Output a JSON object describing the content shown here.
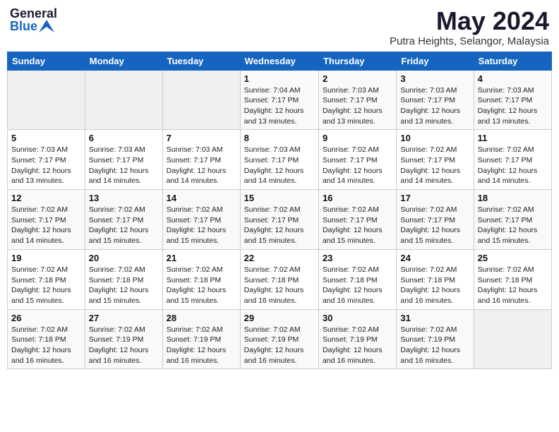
{
  "header": {
    "logo_general": "General",
    "logo_blue": "Blue",
    "month_title": "May 2024",
    "location": "Putra Heights, Selangor, Malaysia"
  },
  "days_of_week": [
    "Sunday",
    "Monday",
    "Tuesday",
    "Wednesday",
    "Thursday",
    "Friday",
    "Saturday"
  ],
  "weeks": [
    [
      {
        "day": "",
        "info": ""
      },
      {
        "day": "",
        "info": ""
      },
      {
        "day": "",
        "info": ""
      },
      {
        "day": "1",
        "info": "Sunrise: 7:04 AM\nSunset: 7:17 PM\nDaylight: 12 hours\nand 13 minutes."
      },
      {
        "day": "2",
        "info": "Sunrise: 7:03 AM\nSunset: 7:17 PM\nDaylight: 12 hours\nand 13 minutes."
      },
      {
        "day": "3",
        "info": "Sunrise: 7:03 AM\nSunset: 7:17 PM\nDaylight: 12 hours\nand 13 minutes."
      },
      {
        "day": "4",
        "info": "Sunrise: 7:03 AM\nSunset: 7:17 PM\nDaylight: 12 hours\nand 13 minutes."
      }
    ],
    [
      {
        "day": "5",
        "info": "Sunrise: 7:03 AM\nSunset: 7:17 PM\nDaylight: 12 hours\nand 13 minutes."
      },
      {
        "day": "6",
        "info": "Sunrise: 7:03 AM\nSunset: 7:17 PM\nDaylight: 12 hours\nand 14 minutes."
      },
      {
        "day": "7",
        "info": "Sunrise: 7:03 AM\nSunset: 7:17 PM\nDaylight: 12 hours\nand 14 minutes."
      },
      {
        "day": "8",
        "info": "Sunrise: 7:03 AM\nSunset: 7:17 PM\nDaylight: 12 hours\nand 14 minutes."
      },
      {
        "day": "9",
        "info": "Sunrise: 7:02 AM\nSunset: 7:17 PM\nDaylight: 12 hours\nand 14 minutes."
      },
      {
        "day": "10",
        "info": "Sunrise: 7:02 AM\nSunset: 7:17 PM\nDaylight: 12 hours\nand 14 minutes."
      },
      {
        "day": "11",
        "info": "Sunrise: 7:02 AM\nSunset: 7:17 PM\nDaylight: 12 hours\nand 14 minutes."
      }
    ],
    [
      {
        "day": "12",
        "info": "Sunrise: 7:02 AM\nSunset: 7:17 PM\nDaylight: 12 hours\nand 14 minutes."
      },
      {
        "day": "13",
        "info": "Sunrise: 7:02 AM\nSunset: 7:17 PM\nDaylight: 12 hours\nand 15 minutes."
      },
      {
        "day": "14",
        "info": "Sunrise: 7:02 AM\nSunset: 7:17 PM\nDaylight: 12 hours\nand 15 minutes."
      },
      {
        "day": "15",
        "info": "Sunrise: 7:02 AM\nSunset: 7:17 PM\nDaylight: 12 hours\nand 15 minutes."
      },
      {
        "day": "16",
        "info": "Sunrise: 7:02 AM\nSunset: 7:17 PM\nDaylight: 12 hours\nand 15 minutes."
      },
      {
        "day": "17",
        "info": "Sunrise: 7:02 AM\nSunset: 7:17 PM\nDaylight: 12 hours\nand 15 minutes."
      },
      {
        "day": "18",
        "info": "Sunrise: 7:02 AM\nSunset: 7:17 PM\nDaylight: 12 hours\nand 15 minutes."
      }
    ],
    [
      {
        "day": "19",
        "info": "Sunrise: 7:02 AM\nSunset: 7:18 PM\nDaylight: 12 hours\nand 15 minutes."
      },
      {
        "day": "20",
        "info": "Sunrise: 7:02 AM\nSunset: 7:18 PM\nDaylight: 12 hours\nand 15 minutes."
      },
      {
        "day": "21",
        "info": "Sunrise: 7:02 AM\nSunset: 7:18 PM\nDaylight: 12 hours\nand 15 minutes."
      },
      {
        "day": "22",
        "info": "Sunrise: 7:02 AM\nSunset: 7:18 PM\nDaylight: 12 hours\nand 16 minutes."
      },
      {
        "day": "23",
        "info": "Sunrise: 7:02 AM\nSunset: 7:18 PM\nDaylight: 12 hours\nand 16 minutes."
      },
      {
        "day": "24",
        "info": "Sunrise: 7:02 AM\nSunset: 7:18 PM\nDaylight: 12 hours\nand 16 minutes."
      },
      {
        "day": "25",
        "info": "Sunrise: 7:02 AM\nSunset: 7:18 PM\nDaylight: 12 hours\nand 16 minutes."
      }
    ],
    [
      {
        "day": "26",
        "info": "Sunrise: 7:02 AM\nSunset: 7:18 PM\nDaylight: 12 hours\nand 16 minutes."
      },
      {
        "day": "27",
        "info": "Sunrise: 7:02 AM\nSunset: 7:19 PM\nDaylight: 12 hours\nand 16 minutes."
      },
      {
        "day": "28",
        "info": "Sunrise: 7:02 AM\nSunset: 7:19 PM\nDaylight: 12 hours\nand 16 minutes."
      },
      {
        "day": "29",
        "info": "Sunrise: 7:02 AM\nSunset: 7:19 PM\nDaylight: 12 hours\nand 16 minutes."
      },
      {
        "day": "30",
        "info": "Sunrise: 7:02 AM\nSunset: 7:19 PM\nDaylight: 12 hours\nand 16 minutes."
      },
      {
        "day": "31",
        "info": "Sunrise: 7:02 AM\nSunset: 7:19 PM\nDaylight: 12 hours\nand 16 minutes."
      },
      {
        "day": "",
        "info": ""
      }
    ]
  ]
}
